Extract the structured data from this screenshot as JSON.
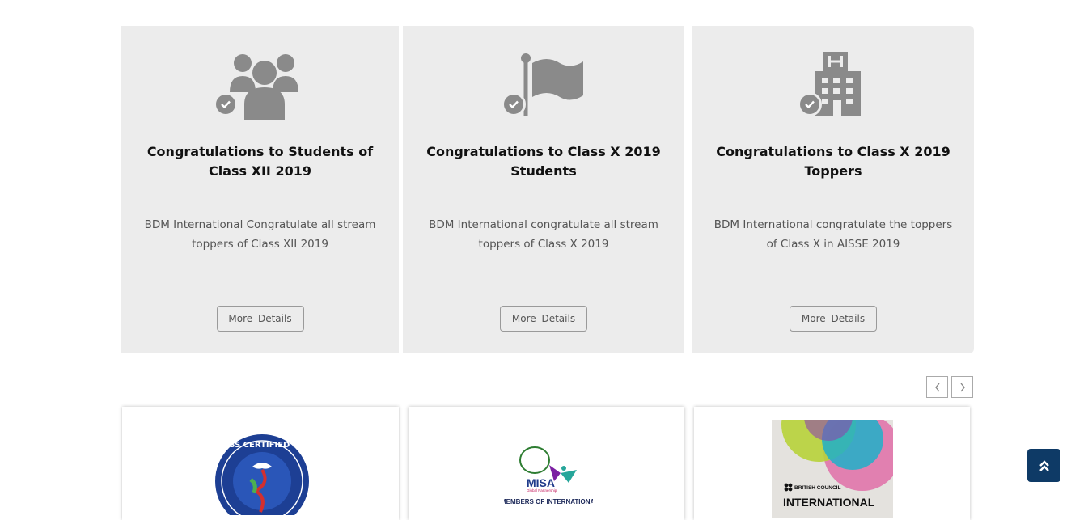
{
  "cards": [
    {
      "icon": "group-users-icon",
      "title": "Congratulations to Students of Class XII 2019",
      "description": "BDM International Congratulate all stream toppers of Class XII 2019",
      "button": "More Details"
    },
    {
      "icon": "flag-icon",
      "title": "Congratulations to Class X 2019 Students",
      "description": "BDM International congratulate all stream toppers of Class X 2019",
      "button": "More Details"
    },
    {
      "icon": "hospital-building-icon",
      "title": "Congratulations to Class X 2019 Toppers",
      "description": "BDM International congratulate the toppers of Class X in AISSE 2019",
      "button": "More Details"
    }
  ],
  "carousel": {
    "prev_icon": "chevron-left-icon",
    "next_icon": "chevron-right-icon"
  },
  "logos": [
    {
      "name": "kindness-certified-school-logo",
      "text": "KINDNESS CERTIFIED SCHOOL"
    },
    {
      "name": "misa-logo",
      "text": "MISA",
      "subtext": "Global Partnership",
      "caption": "MEMBERS OF INTERNATIONAL"
    },
    {
      "name": "british-council-logo",
      "text": "BRITISH COUNCIL",
      "caption": "INTERNATIONAL"
    }
  ],
  "colors": {
    "card_bg": "#ececec",
    "icon_gray": "#8a8a8a",
    "back_to_top_bg": "#0e3a66"
  },
  "back_to_top_icon": "double-chevron-up-icon"
}
